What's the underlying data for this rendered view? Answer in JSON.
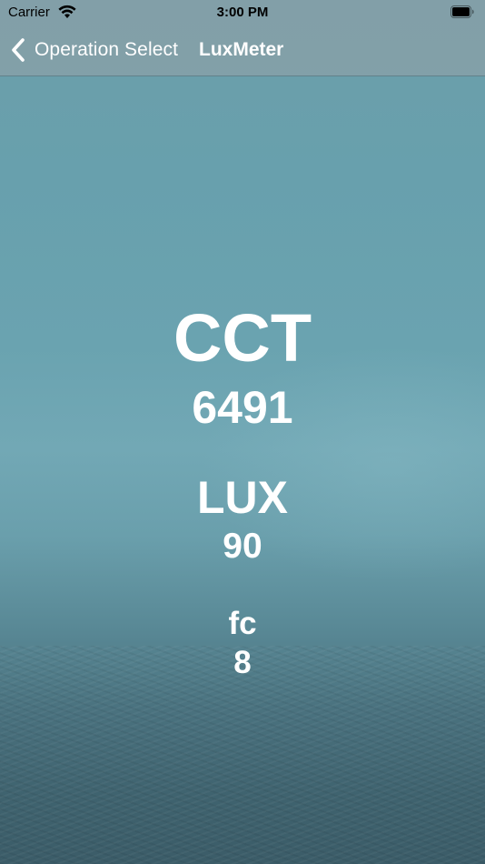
{
  "status_bar": {
    "carrier": "Carrier",
    "time": "3:00 PM",
    "wifi_icon": "wifi-icon",
    "battery_icon": "battery-full-icon"
  },
  "nav_bar": {
    "back_label": "Operation Select",
    "back_icon": "chevron-left-icon",
    "title": "LuxMeter"
  },
  "readings": {
    "cct": {
      "label": "CCT",
      "value": "6491"
    },
    "lux": {
      "label": "LUX",
      "value": "90"
    },
    "fc": {
      "label": "fc",
      "value": "8"
    }
  },
  "colors": {
    "background_top": "#6c9ea9",
    "background_bottom": "#3b5c68",
    "nav_bar": "#84a0a8",
    "text": "#ffffff"
  }
}
